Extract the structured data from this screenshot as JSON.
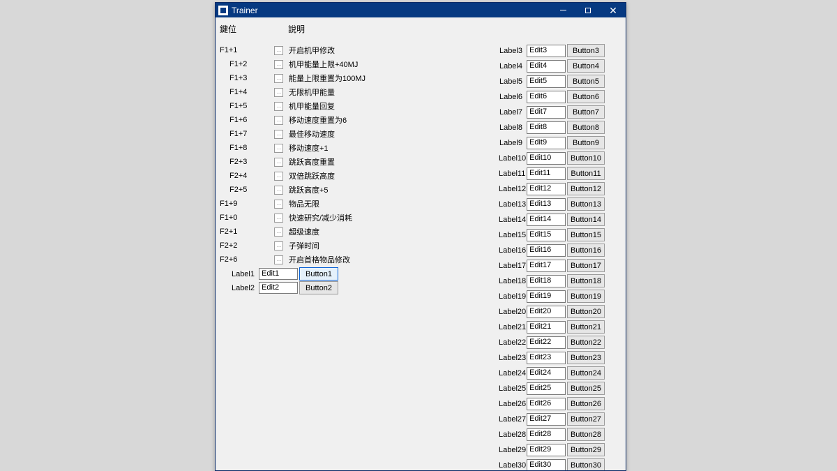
{
  "window": {
    "title": "Trainer",
    "btn_min": "–",
    "btn_max": "▢",
    "btn_close": "✕"
  },
  "headers": {
    "key": "鍵位",
    "desc": "說明"
  },
  "hotkeys": [
    {
      "key": "F1+1",
      "desc": "开启机甲修改",
      "indent": false
    },
    {
      "key": "F1+2",
      "desc": "机甲能量上限+40MJ",
      "indent": true
    },
    {
      "key": "F1+3",
      "desc": "能量上限重置为100MJ",
      "indent": true
    },
    {
      "key": "F1+4",
      "desc": "无限机甲能量",
      "indent": true
    },
    {
      "key": "F1+5",
      "desc": "机甲能量回复",
      "indent": true
    },
    {
      "key": "F1+6",
      "desc": "移动速度重置为6",
      "indent": true
    },
    {
      "key": "F1+7",
      "desc": "最佳移动速度",
      "indent": true
    },
    {
      "key": "F1+8",
      "desc": "移动速度+1",
      "indent": true
    },
    {
      "key": "F2+3",
      "desc": "跳跃高度重置",
      "indent": true
    },
    {
      "key": "F2+4",
      "desc": "双倍跳跃高度",
      "indent": true
    },
    {
      "key": "F2+5",
      "desc": "跳跃高度+5",
      "indent": true
    },
    {
      "key": "F1+9",
      "desc": "物品无限",
      "indent": false
    },
    {
      "key": "F1+0",
      "desc": "快速研究/减少消耗",
      "indent": false
    },
    {
      "key": "F2+1",
      "desc": "超级速度",
      "indent": false
    },
    {
      "key": "F2+2",
      "desc": "子弹时间",
      "indent": false
    },
    {
      "key": "F2+6",
      "desc": "开启首格物品修改",
      "indent": false
    }
  ],
  "left_rows": [
    {
      "label": "Label1",
      "edit": "Edit1",
      "button": "Button1",
      "highlight": true
    },
    {
      "label": "Label2",
      "edit": "Edit2",
      "button": "Button2",
      "highlight": false
    }
  ],
  "right_rows": [
    {
      "label": "Label3",
      "edit": "Edit3",
      "button": "Button3"
    },
    {
      "label": "Label4",
      "edit": "Edit4",
      "button": "Button4"
    },
    {
      "label": "Label5",
      "edit": "Edit5",
      "button": "Button5"
    },
    {
      "label": "Label6",
      "edit": "Edit6",
      "button": "Button6"
    },
    {
      "label": "Label7",
      "edit": "Edit7",
      "button": "Button7"
    },
    {
      "label": "Label8",
      "edit": "Edit8",
      "button": "Button8"
    },
    {
      "label": "Label9",
      "edit": "Edit9",
      "button": "Button9"
    },
    {
      "label": "Label10",
      "edit": "Edit10",
      "button": "Button10"
    },
    {
      "label": "Label11",
      "edit": "Edit11",
      "button": "Button11"
    },
    {
      "label": "Label12",
      "edit": "Edit12",
      "button": "Button12"
    },
    {
      "label": "Label13",
      "edit": "Edit13",
      "button": "Button13"
    },
    {
      "label": "Label14",
      "edit": "Edit14",
      "button": "Button14"
    },
    {
      "label": "Label15",
      "edit": "Edit15",
      "button": "Button15"
    },
    {
      "label": "Label16",
      "edit": "Edit16",
      "button": "Button16"
    },
    {
      "label": "Label17",
      "edit": "Edit17",
      "button": "Button17"
    },
    {
      "label": "Label18",
      "edit": "Edit18",
      "button": "Button18"
    },
    {
      "label": "Label19",
      "edit": "Edit19",
      "button": "Button19"
    },
    {
      "label": "Label20",
      "edit": "Edit20",
      "button": "Button20"
    },
    {
      "label": "Label21",
      "edit": "Edit21",
      "button": "Button21"
    },
    {
      "label": "Label22",
      "edit": "Edit22",
      "button": "Button22"
    },
    {
      "label": "Label23",
      "edit": "Edit23",
      "button": "Button23"
    },
    {
      "label": "Label24",
      "edit": "Edit24",
      "button": "Button24"
    },
    {
      "label": "Label25",
      "edit": "Edit25",
      "button": "Button25"
    },
    {
      "label": "Label26",
      "edit": "Edit26",
      "button": "Button26"
    },
    {
      "label": "Label27",
      "edit": "Edit27",
      "button": "Button27"
    },
    {
      "label": "Label28",
      "edit": "Edit28",
      "button": "Button28"
    },
    {
      "label": "Label29",
      "edit": "Edit29",
      "button": "Button29"
    },
    {
      "label": "Label30",
      "edit": "Edit30",
      "button": "Button30"
    }
  ]
}
